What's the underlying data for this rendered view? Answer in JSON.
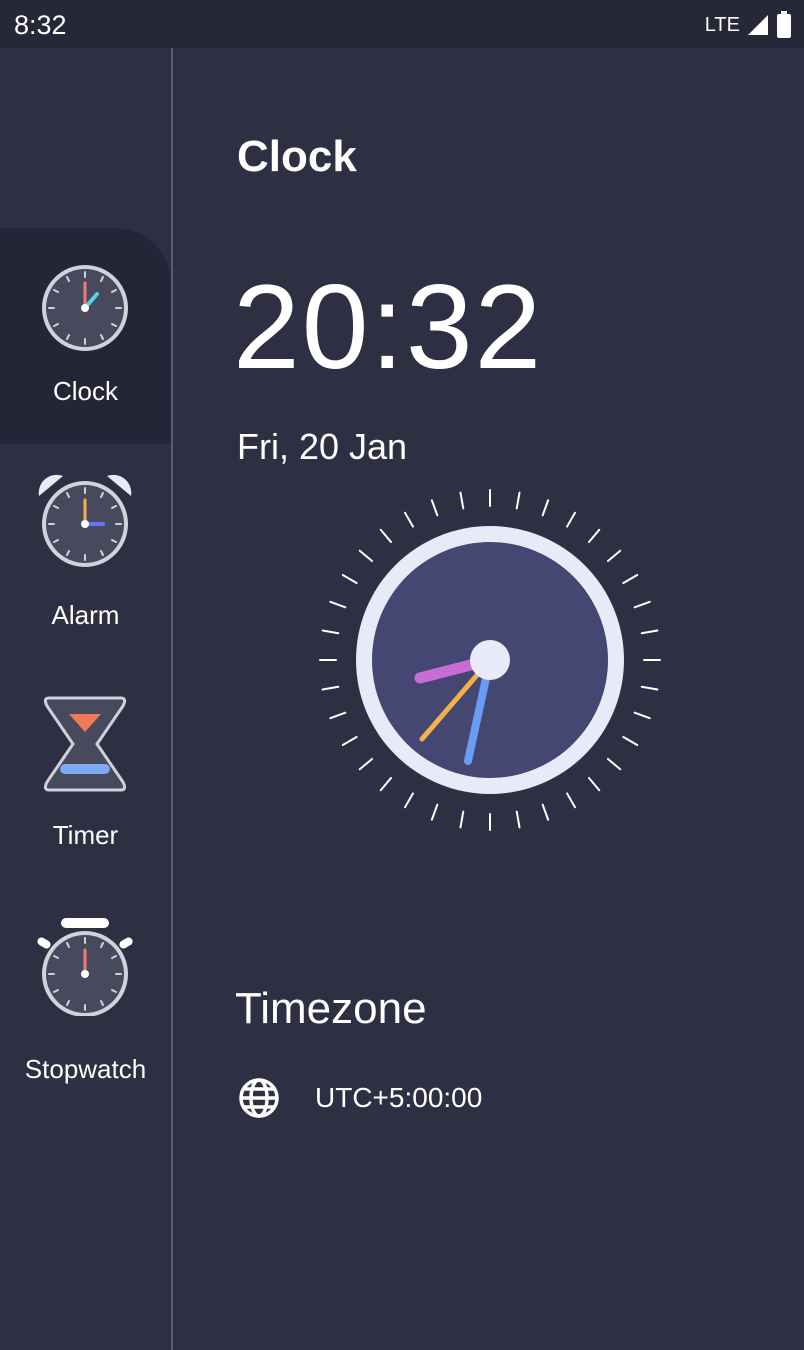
{
  "status_bar": {
    "time": "8:32",
    "network": "LTE"
  },
  "sidebar": {
    "items": [
      {
        "label": "Clock",
        "icon": "clock-icon",
        "active": true
      },
      {
        "label": "Alarm",
        "icon": "alarm-icon",
        "active": false
      },
      {
        "label": "Timer",
        "icon": "hourglass-icon",
        "active": false
      },
      {
        "label": "Stopwatch",
        "icon": "stopwatch-icon",
        "active": false
      }
    ]
  },
  "main": {
    "title": "Clock",
    "digital_time": "20:32",
    "date": "Fri, 20 Jan",
    "timezone_title": "Timezone",
    "timezone_value": "UTC+5:00:00",
    "timezone_icon": "globe-icon"
  },
  "colors": {
    "background": "#2e2f43",
    "sidebar_active": "#242536",
    "status_bar": "#262737",
    "clock_face": "#434771",
    "clock_ring": "#e8eaf8",
    "hour_hand": "#c86dd7",
    "minute_hand": "#6b9cf5",
    "second_hand": "#f5b04a"
  }
}
